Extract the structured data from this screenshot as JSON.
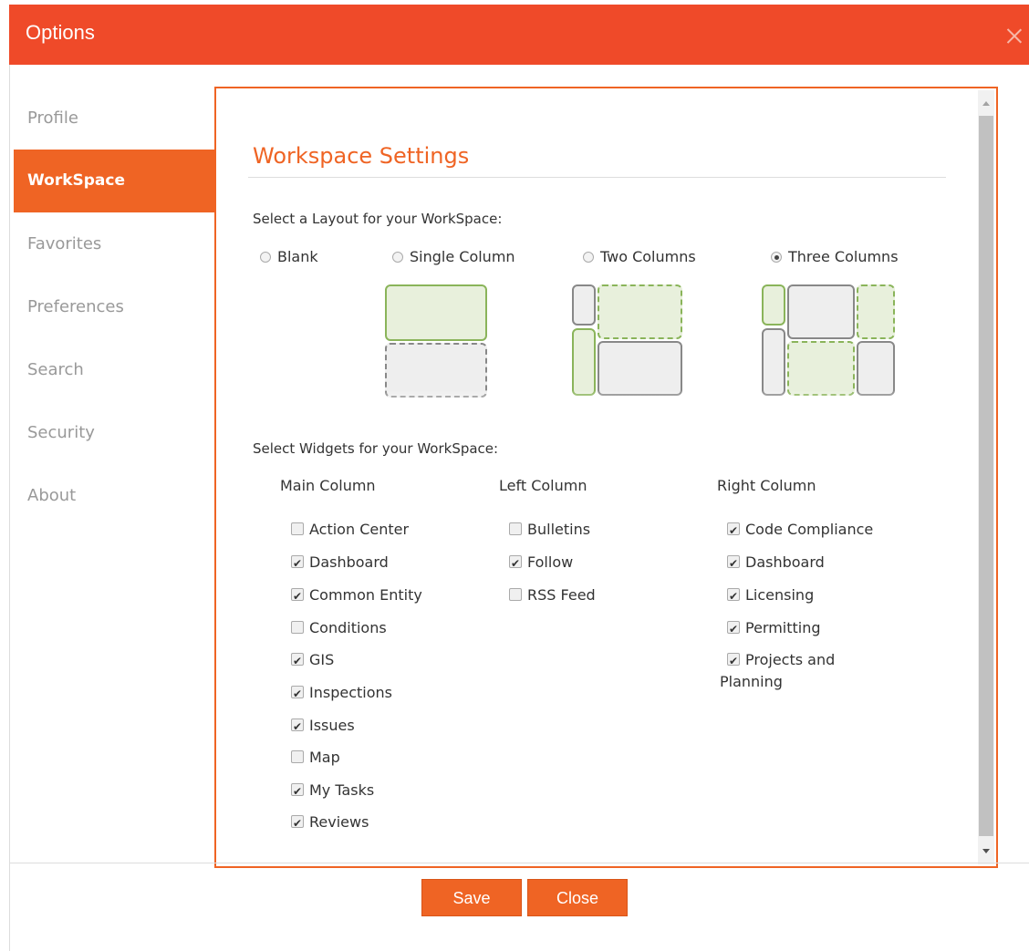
{
  "dialog": {
    "title": "Options"
  },
  "sidebar": {
    "items": [
      {
        "label": "Profile"
      },
      {
        "label": "WorkSpace"
      },
      {
        "label": "Favorites"
      },
      {
        "label": "Preferences"
      },
      {
        "label": "Search"
      },
      {
        "label": "Security"
      },
      {
        "label": "About"
      }
    ],
    "active": "WorkSpace"
  },
  "workspace": {
    "title": "Workspace Settings",
    "layout_label": "Select a Layout for your WorkSpace:",
    "layouts": [
      {
        "label": "Blank",
        "selected": false
      },
      {
        "label": "Single Column",
        "selected": false
      },
      {
        "label": "Two Columns",
        "selected": false
      },
      {
        "label": "Three Columns",
        "selected": true
      }
    ],
    "widgets_label": "Select Widgets for your WorkSpace:",
    "columns": [
      {
        "heading": "Main Column",
        "widgets": [
          {
            "label": "Action Center",
            "checked": false
          },
          {
            "label": "Dashboard",
            "checked": true
          },
          {
            "label": "Common Entity",
            "checked": true
          },
          {
            "label": "Conditions",
            "checked": false
          },
          {
            "label": "GIS",
            "checked": true
          },
          {
            "label": "Inspections",
            "checked": true
          },
          {
            "label": "Issues",
            "checked": true
          },
          {
            "label": "Map",
            "checked": false
          },
          {
            "label": "My Tasks",
            "checked": true
          },
          {
            "label": "Reviews",
            "checked": true
          }
        ]
      },
      {
        "heading": "Left Column",
        "widgets": [
          {
            "label": "Bulletins",
            "checked": false
          },
          {
            "label": "Follow",
            "checked": true
          },
          {
            "label": "RSS Feed",
            "checked": false
          }
        ]
      },
      {
        "heading": "Right Column",
        "widgets": [
          {
            "label": "Code Compliance",
            "checked": true
          },
          {
            "label": "Dashboard",
            "checked": true
          },
          {
            "label": "Licensing",
            "checked": true
          },
          {
            "label": "Permitting",
            "checked": true
          },
          {
            "label": "Projects and Planning",
            "checked": true
          }
        ]
      }
    ]
  },
  "footer": {
    "save_label": "Save",
    "close_label": "Close"
  },
  "colors": {
    "header": "#ef4a29",
    "accent": "#ef6424",
    "layout_green": "#8ab45a"
  }
}
